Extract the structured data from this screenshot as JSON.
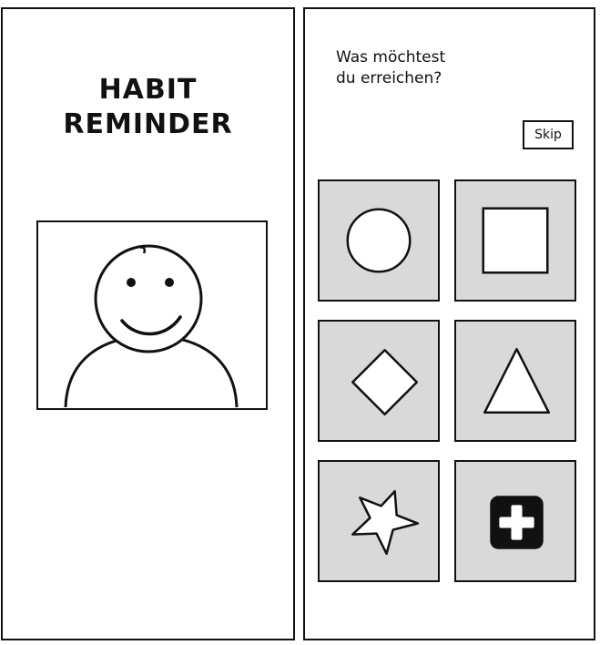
{
  "left_screen": {
    "title_lines": [
      "HABIT",
      "REMINDER"
    ],
    "avatar_icon": "smiley-person-icon"
  },
  "right_screen": {
    "question_lines": [
      "Was möchtest",
      "du erreichen?"
    ],
    "skip_label": "Skip",
    "options": [
      {
        "icon": "circle-icon"
      },
      {
        "icon": "square-icon"
      },
      {
        "icon": "diamond-icon"
      },
      {
        "icon": "triangle-icon"
      },
      {
        "icon": "star-icon"
      },
      {
        "icon": "add-icon"
      }
    ]
  },
  "colors": {
    "tile_background": "#d9d9d9",
    "stroke": "#111111",
    "add_icon_fill": "#111111"
  }
}
